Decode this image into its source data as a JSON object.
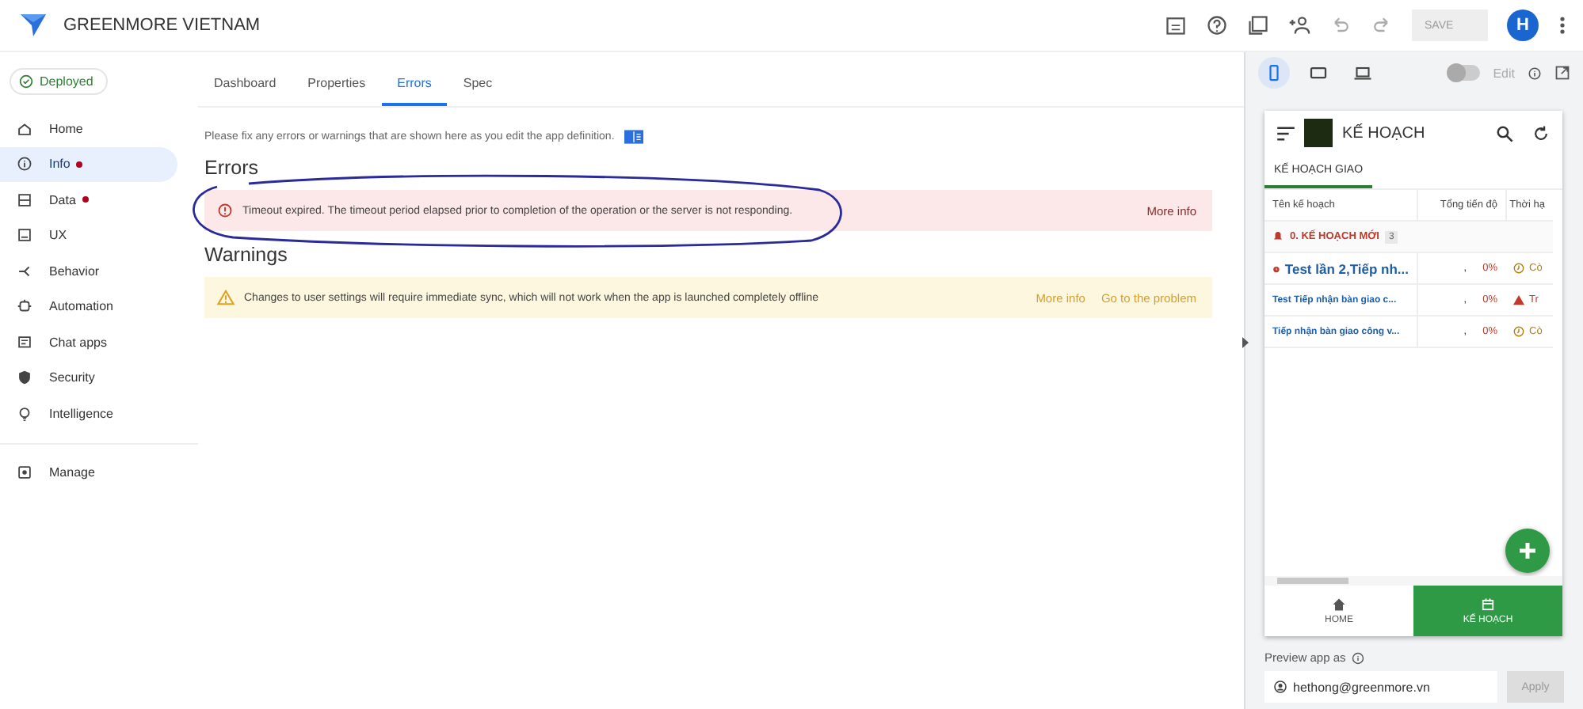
{
  "app": {
    "name": "GREENMORE VIETNAM",
    "status": "Deployed"
  },
  "toolbar": {
    "save_label": "SAVE",
    "save_disabled": true,
    "avatar": "H"
  },
  "sidebar": {
    "items": [
      {
        "label": "Home",
        "selected": false,
        "alert": false
      },
      {
        "label": "Info",
        "selected": true,
        "alert": true
      },
      {
        "label": "Data",
        "selected": false,
        "alert": true
      },
      {
        "label": "UX",
        "selected": false,
        "alert": false
      },
      {
        "label": "Behavior",
        "selected": false,
        "alert": false
      },
      {
        "label": "Automation",
        "selected": false,
        "alert": false
      },
      {
        "label": "Chat apps",
        "selected": false,
        "alert": false
      },
      {
        "label": "Security",
        "selected": false,
        "alert": false
      },
      {
        "label": "Intelligence",
        "selected": false,
        "alert": false
      }
    ],
    "footer_items": [
      {
        "label": "Manage",
        "selected": false,
        "alert": false
      }
    ]
  },
  "tabs": [
    {
      "label": "Dashboard",
      "selected": false
    },
    {
      "label": "Properties",
      "selected": false
    },
    {
      "label": "Errors",
      "selected": true
    },
    {
      "label": "Spec",
      "selected": false
    }
  ],
  "intro": "Please fix any errors or warnings that are shown here as you edit the app definition.",
  "errors": {
    "title": "Errors",
    "items": [
      {
        "message": "Timeout expired. The timeout period elapsed prior to completion of the operation or the server is not responding.",
        "actions": [
          "More info"
        ]
      }
    ]
  },
  "warnings": {
    "title": "Warnings",
    "items": [
      {
        "message": "Changes to user settings will require immediate sync, which will not work when the app is launched completely offline",
        "actions": [
          "More info",
          "Go to the problem"
        ]
      }
    ]
  },
  "preview": {
    "devices": [
      {
        "kind": "phone",
        "selected": true
      },
      {
        "kind": "tablet",
        "selected": false
      },
      {
        "kind": "desktop",
        "selected": false
      }
    ],
    "edit": {
      "label": "Edit",
      "on": false
    },
    "app_title": "KẾ HOẠCH",
    "view_tab": "KẾ HOẠCH GIAO",
    "columns": [
      "Tên kế hoạch",
      "Tổng tiến độ",
      "Thời hạ"
    ],
    "group": {
      "label": "0. KẾ HOẠCH MỚI",
      "count": "3"
    },
    "rows": [
      {
        "name": "Test lần 2,Tiếp nh...",
        "kind": "alarm",
        "mark": ",",
        "progress": "0%",
        "deadline": "Cò"
      },
      {
        "name": "Test Tiếp nhận bàn giao c...",
        "kind": "overdue",
        "mark": ",",
        "progress": "0%",
        "deadline": "Tr"
      },
      {
        "name": "Tiếp nhận bàn giao công v...",
        "kind": "pending",
        "mark": ",",
        "progress": "0%",
        "deadline": "Cò"
      }
    ],
    "nav": [
      {
        "label": "HOME",
        "selected": false
      },
      {
        "label": "KẾ HOẠCH",
        "selected": true
      }
    ],
    "preview_as_label": "Preview app as",
    "user": "hethong@greenmore.vn",
    "apply_label": "Apply",
    "apply_disabled": true
  }
}
